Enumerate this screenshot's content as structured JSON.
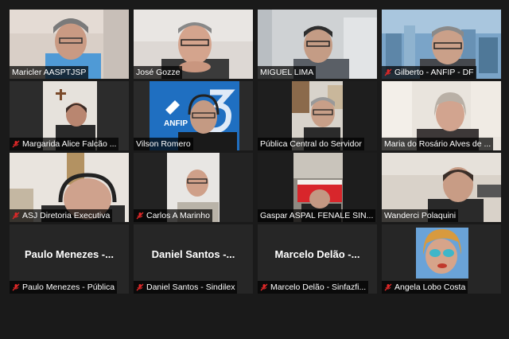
{
  "meeting": {
    "participants": [
      {
        "name": "Maricler AASPTJSP",
        "muted": false
      },
      {
        "name": "José Gozze",
        "muted": false
      },
      {
        "name": "MIGUEL LIMA",
        "muted": false
      },
      {
        "name": "Gilberto - ANFIP - DF",
        "muted": true
      },
      {
        "name": "Margarida Alice Falcão ...",
        "muted": true
      },
      {
        "name": "Vilson Romero",
        "muted": false,
        "active_speaker": true,
        "background_text": "ANFIP"
      },
      {
        "name": "Pública Central do Servidor",
        "muted": false
      },
      {
        "name": "Maria do Rosário Alves de ...",
        "muted": false
      },
      {
        "name": "ASJ Diretoria Executiva",
        "muted": true
      },
      {
        "name": "Carlos A Marinho",
        "muted": true
      },
      {
        "name": "Gaspar ASPAL FENALE SIN...",
        "muted": false
      },
      {
        "name": "Wanderci Polaquini",
        "muted": false
      },
      {
        "name": "Paulo Menezes - Pública",
        "muted": true,
        "display_name": "Paulo Menezes -..."
      },
      {
        "name": "Daniel Santos - Sindilex",
        "muted": true,
        "display_name": "Daniel Santos -..."
      },
      {
        "name": "Marcelo Delão - Sinfazfi...",
        "muted": true,
        "display_name": "Marcelo Delão -..."
      },
      {
        "name": "Angela Lobo Costa",
        "muted": true
      }
    ]
  },
  "colors": {
    "active_border": "#e7e46a",
    "mute_icon": "#e02828",
    "tile_bg": "#262626"
  }
}
